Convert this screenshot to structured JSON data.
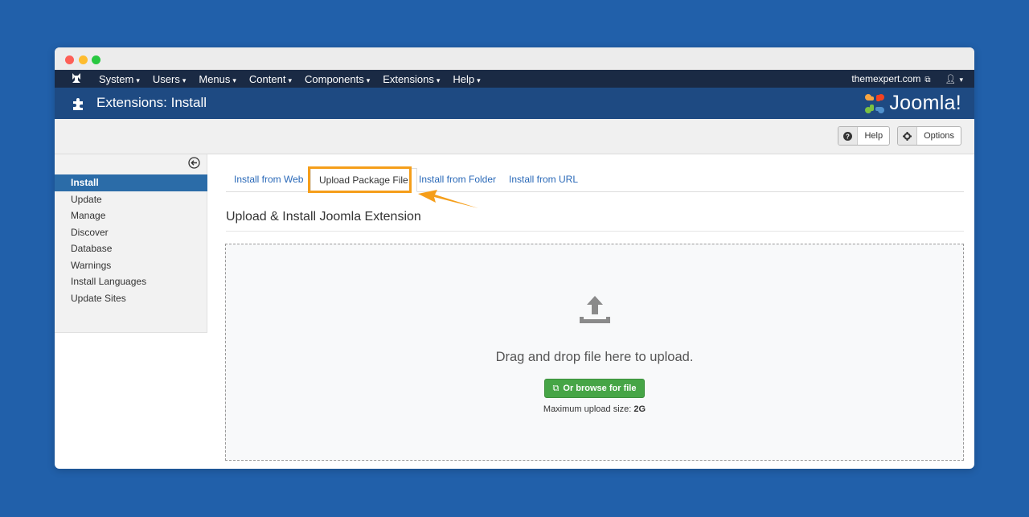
{
  "navbar": {
    "menus": [
      {
        "label": "System"
      },
      {
        "label": "Users"
      },
      {
        "label": "Menus"
      },
      {
        "label": "Content"
      },
      {
        "label": "Components"
      },
      {
        "label": "Extensions"
      },
      {
        "label": "Help"
      }
    ],
    "site_link": "themexpert.com",
    "user_icon": "user-icon"
  },
  "header": {
    "title": "Extensions: Install",
    "logo_text": "Joomla!"
  },
  "toolbar": {
    "help_label": "Help",
    "options_label": "Options"
  },
  "sidebar": {
    "items": [
      {
        "label": "Install"
      },
      {
        "label": "Update"
      },
      {
        "label": "Manage"
      },
      {
        "label": "Discover"
      },
      {
        "label": "Database"
      },
      {
        "label": "Warnings"
      },
      {
        "label": "Install Languages"
      },
      {
        "label": "Update Sites"
      }
    ],
    "active": "Install"
  },
  "tabs": [
    {
      "label": "Install from Web"
    },
    {
      "label": "Upload Package File"
    },
    {
      "label": "Install from Folder"
    },
    {
      "label": "Install from URL"
    }
  ],
  "active_tab": "Upload Package File",
  "main": {
    "section_title": "Upload & Install Joomla Extension",
    "drop_text": "Drag and drop file here to upload.",
    "browse_label": "Or browse for file",
    "max_label": "Maximum upload size:",
    "max_value": "2G"
  },
  "colors": {
    "background": "#2160aa",
    "navbar": "#1a2a44",
    "header": "#1e4a82",
    "highlight": "#f59e1a",
    "browse_button": "#46a546",
    "active_sidebar": "#2b6ca8"
  }
}
